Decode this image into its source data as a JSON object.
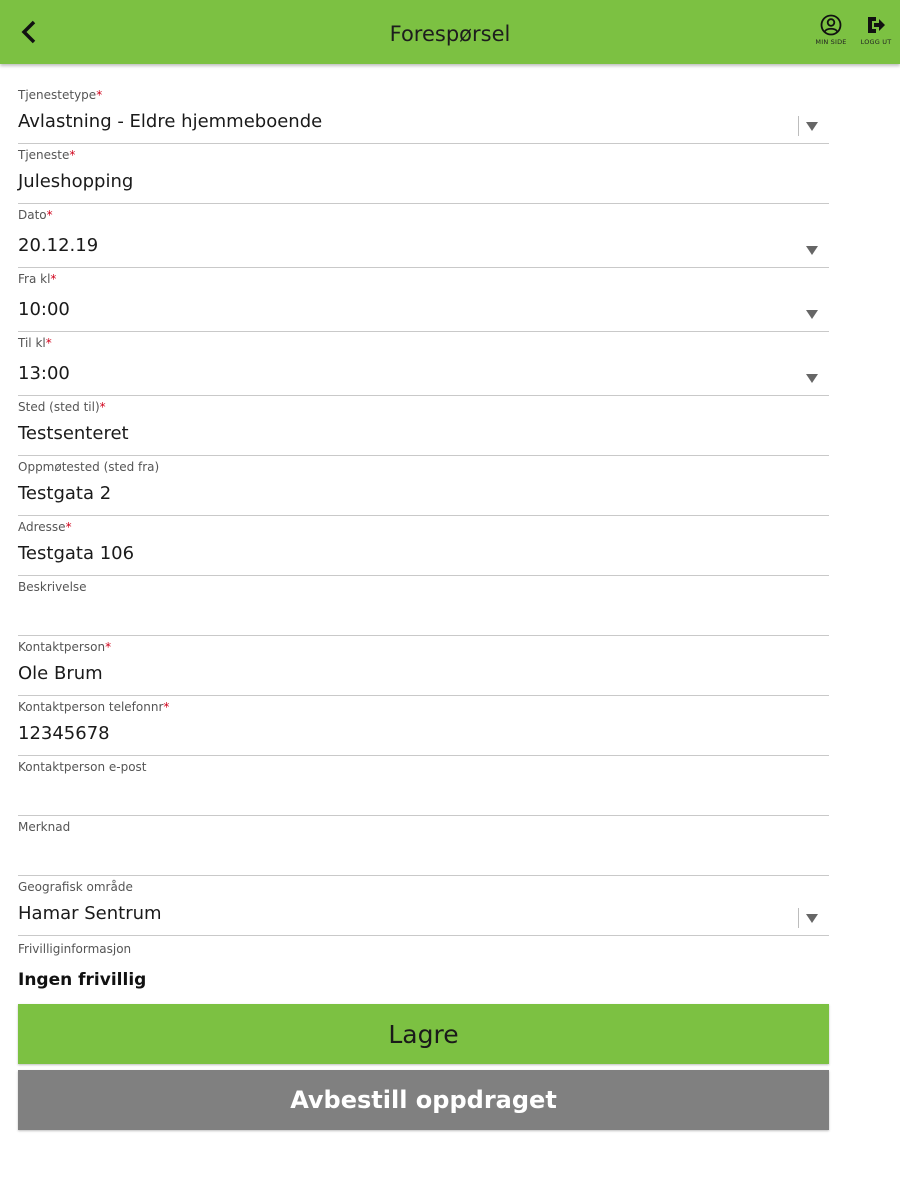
{
  "header": {
    "title": "Forespørsel",
    "back_icon": "chevron-left-icon",
    "actions": [
      {
        "label": "MIN SIDE",
        "icon": "user-circle-icon"
      },
      {
        "label": "LOGG UT",
        "icon": "logout-icon"
      }
    ],
    "color": "#7cc142"
  },
  "required_marker": "*",
  "fields": {
    "tjenestetype": {
      "label": "Tjenestetype",
      "value": "Avlastning - Eldre hjemmeboende",
      "required": true,
      "type": "select"
    },
    "tjeneste": {
      "label": "Tjeneste",
      "value": "Juleshopping",
      "required": true,
      "type": "text"
    },
    "dato": {
      "label": "Dato",
      "value": "20.12.19",
      "required": true,
      "type": "select"
    },
    "fra_kl": {
      "label": "Fra kl",
      "value": "10:00",
      "required": true,
      "type": "select"
    },
    "til_kl": {
      "label": "Til kl",
      "value": "13:00",
      "required": true,
      "type": "select"
    },
    "sted": {
      "label": "Sted (sted til)",
      "value": "Testsenteret",
      "required": true,
      "type": "text"
    },
    "oppmotested": {
      "label": "Oppmøtested (sted fra)",
      "value": "Testgata 2",
      "required": false,
      "type": "text"
    },
    "adresse": {
      "label": "Adresse",
      "value": "Testgata 106",
      "required": true,
      "type": "text"
    },
    "beskrivelse": {
      "label": "Beskrivelse",
      "value": "",
      "required": false,
      "type": "text"
    },
    "kontaktperson": {
      "label": "Kontaktperson",
      "value": "Ole Brum",
      "required": true,
      "type": "text"
    },
    "kontakt_tlf": {
      "label": "Kontaktperson telefonnr",
      "value": "12345678",
      "required": true,
      "type": "text"
    },
    "kontakt_epost": {
      "label": "Kontaktperson e-post",
      "value": "",
      "required": false,
      "type": "text"
    },
    "merknad": {
      "label": "Merknad",
      "value": "",
      "required": false,
      "type": "text"
    },
    "geografisk": {
      "label": "Geografisk område",
      "value": "Hamar Sentrum",
      "required": false,
      "type": "select"
    }
  },
  "frivillig": {
    "label": "Frivilliginformasjon",
    "value": "Ingen frivillig"
  },
  "buttons": {
    "save": "Lagre",
    "cancel": "Avbestill oppdraget",
    "save_color": "#7cc142",
    "cancel_color": "#808080"
  }
}
